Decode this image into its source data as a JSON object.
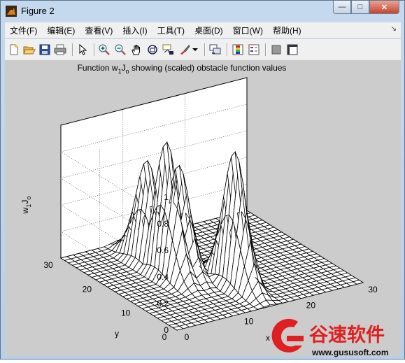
{
  "window": {
    "title": "Figure 2",
    "minimize_glyph": "—",
    "maximize_glyph": "□",
    "close_glyph": "✕"
  },
  "menu": [
    "文件(F)",
    "编辑(E)",
    "查看(V)",
    "插入(I)",
    "工具(T)",
    "桌面(D)",
    "窗口(W)",
    "帮助(H)"
  ],
  "menu_dock_glyph": "↘",
  "toolbar": [
    "new-figure-icon",
    "open-file-icon",
    "save-icon",
    "print-icon",
    "select-arrow-icon",
    "zoom-in-icon",
    "zoom-out-icon",
    "pan-hand-icon",
    "rotate-3d-icon",
    "data-cursor-icon",
    "brush-icon",
    "dropdown-arrow-icon",
    "link-plot-icon",
    "colorbar-icon",
    "legend-icon",
    "hide-plot-tools-icon",
    "show-plot-tools-icon"
  ],
  "plot": {
    "title_prefix": "Function w",
    "title_sub1": "1",
    "title_mid": "J",
    "title_sub2": "o",
    "title_suffix": " showing (scaled) obstacle function values",
    "zlabel_w": "w",
    "zlabel_w_sub": "1",
    "zlabel_j": "J",
    "zlabel_j_sub": "o",
    "xlabel": "x",
    "ylabel": "y"
  },
  "chart_data": {
    "type": "surface",
    "title": "Function w1Jo showing (scaled) obstacle function values",
    "xlabel": "x",
    "ylabel": "y",
    "zlabel": "w1Jo",
    "xlim": [
      0,
      30
    ],
    "ylim": [
      0,
      30
    ],
    "zlim": [
      0,
      1
    ],
    "x_ticks": [
      "0",
      "10",
      "20",
      "30"
    ],
    "y_ticks": [
      "0",
      "10",
      "20",
      "30"
    ],
    "z_ticks": [
      "0",
      "0.2",
      "0.4",
      "0.6",
      "0.8",
      "1"
    ],
    "grid": true,
    "peaks": [
      {
        "x": 9,
        "y": 17,
        "height": 1.0
      },
      {
        "x": 9,
        "y": 22,
        "height": 0.77
      },
      {
        "x": 11,
        "y": 17,
        "height": 0.8
      },
      {
        "x": 15,
        "y": 9,
        "height": 1.0
      }
    ]
  },
  "watermark": {
    "brand_text": "谷速软件",
    "url_text": "www.gususoft.com",
    "color": "#e02020"
  }
}
